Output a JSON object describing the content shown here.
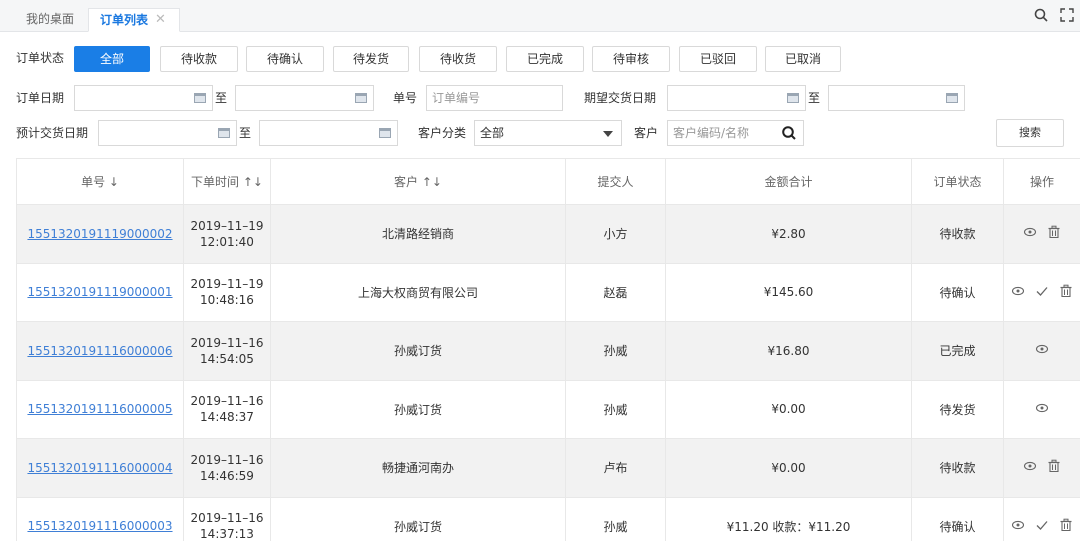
{
  "tabs": {
    "home": "我的桌面",
    "active": "订单列表",
    "close": "✕"
  },
  "filters": {
    "status_label": "订单状态",
    "status_buttons": [
      "全部",
      "待收款",
      "待确认",
      "待发货",
      "待收货",
      "已完成",
      "待审核",
      "已驳回",
      "已取消"
    ],
    "order_date_label": "订单日期",
    "to": "至",
    "order_no_label": "单号",
    "order_no_placeholder": "订单编号",
    "expected_date_label": "期望交货日期",
    "est_date_label": "预计交货日期",
    "customer_category_label": "客户分类",
    "customer_category_value": "全部",
    "customer_label": "客户",
    "customer_placeholder": "客户编码/名称",
    "search_button": "搜索"
  },
  "table": {
    "columns": [
      "单号 ↓",
      "下单时间 ↑↓",
      "客户 ↑↓",
      "提交人",
      "金额合计",
      "订单状态",
      "操作"
    ],
    "rows": [
      {
        "no": "1551320191119000002",
        "date": "2019–11–19",
        "time": "12:01:40",
        "customer": "北清路经销商",
        "submitter": "小方",
        "amount": "¥2.80",
        "status": "待收款",
        "ops": [
          "view",
          "delete"
        ]
      },
      {
        "no": "1551320191119000001",
        "date": "2019–11–19",
        "time": "10:48:16",
        "customer": "上海大权商贸有限公司",
        "submitter": "赵磊",
        "amount": "¥145.60",
        "status": "待确认",
        "ops": [
          "view",
          "confirm",
          "delete"
        ]
      },
      {
        "no": "1551320191116000006",
        "date": "2019–11–16",
        "time": "14:54:05",
        "customer": "孙威订货",
        "submitter": "孙威",
        "amount": "¥16.80",
        "status": "已完成",
        "ops": [
          "view"
        ]
      },
      {
        "no": "1551320191116000005",
        "date": "2019–11–16",
        "time": "14:48:37",
        "customer": "孙威订货",
        "submitter": "孙威",
        "amount": "¥0.00",
        "status": "待发货",
        "ops": [
          "view"
        ]
      },
      {
        "no": "1551320191116000004",
        "date": "2019–11–16",
        "time": "14:46:59",
        "customer": "畅捷通河南办",
        "submitter": "卢布",
        "amount": "¥0.00",
        "status": "待收款",
        "ops": [
          "view",
          "delete"
        ]
      },
      {
        "no": "1551320191116000003",
        "date": "2019–11–16",
        "time": "14:37:13",
        "customer": "孙威订货",
        "submitter": "孙威",
        "amount": "¥11.20 收款：¥11.20",
        "status": "待确认",
        "ops": [
          "view",
          "confirm",
          "delete"
        ]
      }
    ]
  },
  "colors": {
    "accent": "#1a7ee6",
    "link": "#3f7fd6",
    "row_stripe": "#f2f2f2"
  }
}
